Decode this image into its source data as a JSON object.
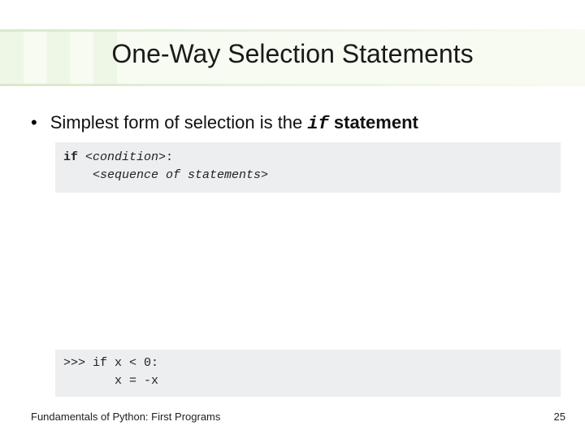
{
  "slide": {
    "title": "One-Way Selection Statements",
    "bullet": {
      "prefix": "Simplest form of selection is the ",
      "code": "if",
      "suffix": " statement"
    },
    "code_block_1": {
      "line1_kw": "if ",
      "line1_ph": "<condition>",
      "line1_colon": ":",
      "line2_ph": "<sequence of statements>"
    },
    "code_block_2": {
      "line1_prompt": ">>> ",
      "line1_kw": "if",
      "line1_rest": " x < 0:",
      "line2": "x = -x"
    },
    "footer_left": "Fundamentals of Python: First Programs",
    "footer_right": "25"
  }
}
